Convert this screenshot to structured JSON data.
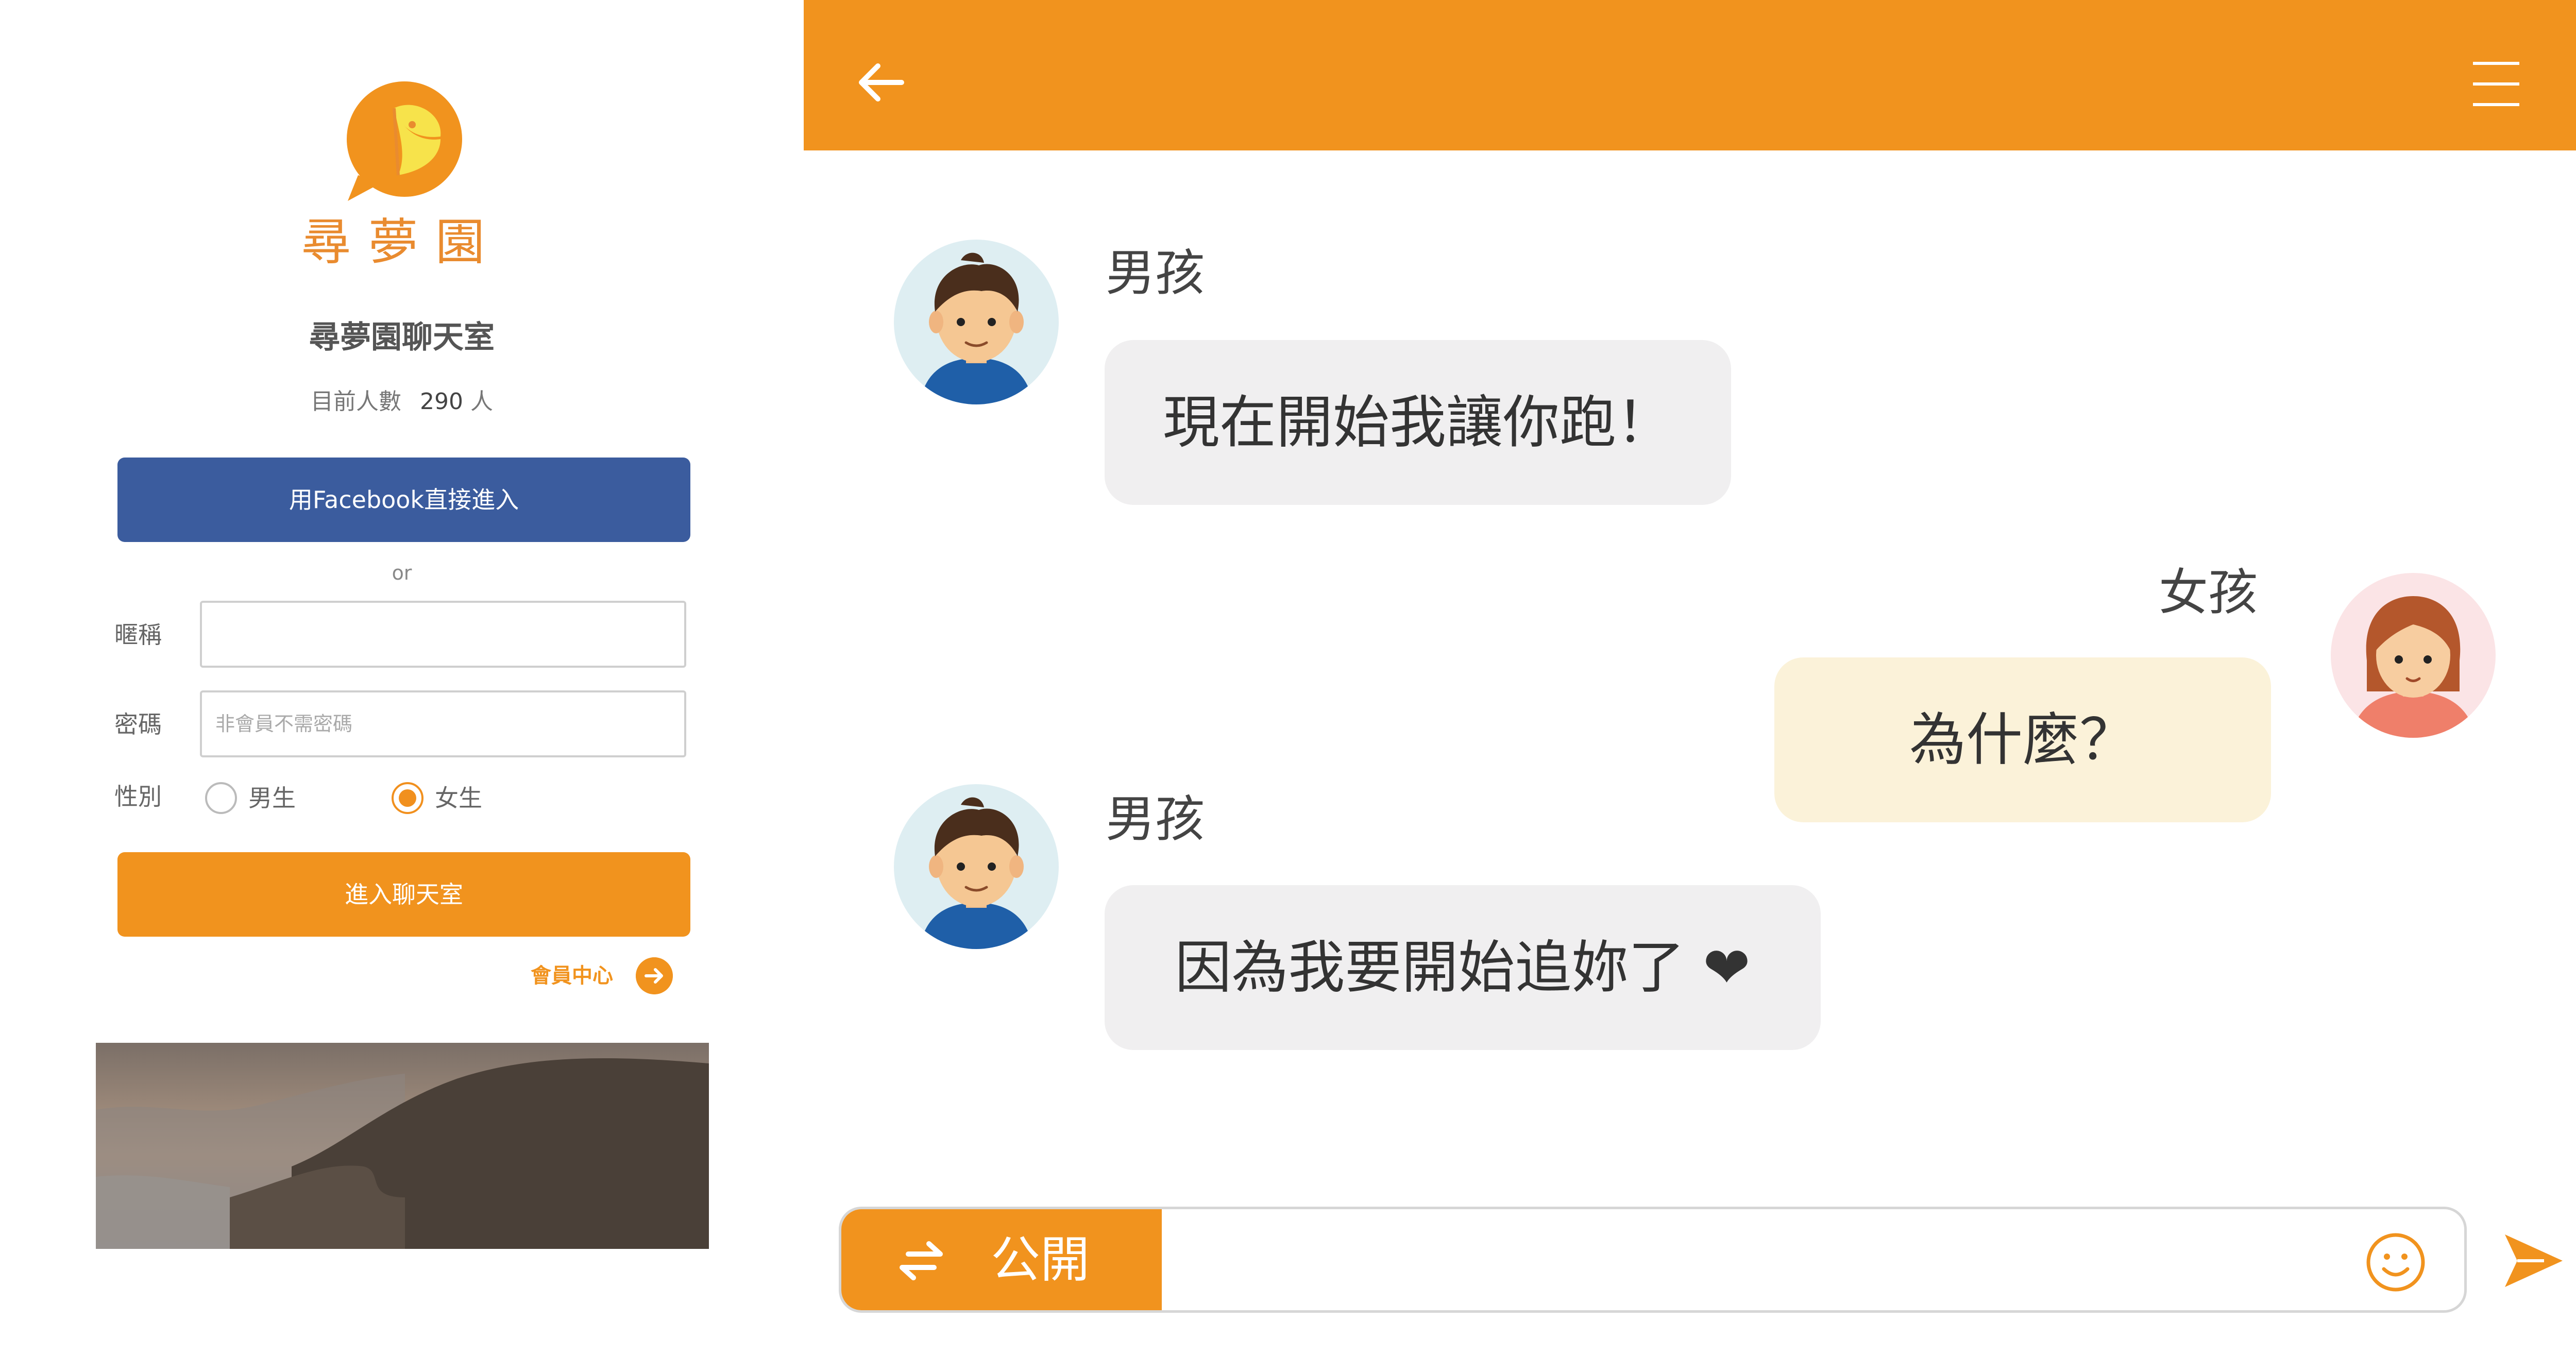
{
  "login": {
    "logo_text": "尋夢園",
    "title": "尋夢園聊天室",
    "online_label": "目前人數",
    "online_count": "290",
    "online_unit": "人",
    "facebook_button": "用Facebook直接進入",
    "or_text": "or",
    "nickname_label": "暱稱",
    "nickname_value": "",
    "password_label": "密碼",
    "password_placeholder": "非會員不需密碼",
    "gender_label": "性別",
    "gender_options": [
      "男生",
      "女生"
    ],
    "gender_selected": "女生",
    "enter_button": "進入聊天室",
    "member_center": "會員中心"
  },
  "chat": {
    "messages": [
      {
        "sender": "男孩",
        "text": "現在開始我讓你跑！",
        "side": "left"
      },
      {
        "sender": "女孩",
        "text": "為什麼？",
        "side": "right"
      },
      {
        "sender": "男孩",
        "text": "因為我要開始追妳了 ❤",
        "side": "left"
      }
    ],
    "channel_label": "公開",
    "message_input_value": ""
  },
  "icons": {
    "header_back": "back-arrow-icon",
    "header_menu": "hamburger-menu-icon",
    "channel_switch": "swap-arrows-icon",
    "emoji": "smiley-icon",
    "send": "send-icon",
    "member_center_arrow": "arrow-right-circle-icon"
  },
  "colors": {
    "accent": "#f1931e",
    "facebook": "#3b5c9e",
    "bubble_left": "#f0eff0",
    "bubble_right": "#fbf2d9"
  }
}
